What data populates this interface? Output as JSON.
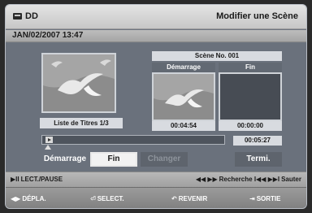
{
  "header": {
    "device": "DD",
    "title": "Modifier une Scène"
  },
  "date": "JAN/02/2007 13:47",
  "left": {
    "list_label": "Liste de Titres 1/3"
  },
  "scene": {
    "label": "Scène No. 001",
    "start_label": "Démarrage",
    "end_label": "Fin",
    "start_time": "00:04:54",
    "end_time": "00:00:00"
  },
  "progress": {
    "total": "00:05:27"
  },
  "buttons": {
    "start": "Démarrage",
    "fin": "Fin",
    "changer": "Changer",
    "termi": "Termi."
  },
  "help": {
    "left": "LECT./PAUSE",
    "right": "Recherche",
    "right2": "Sauter"
  },
  "footer": {
    "move": "DÉPLA.",
    "select": "SELECT.",
    "back": "REVENIR",
    "exit": "SORTIE"
  }
}
